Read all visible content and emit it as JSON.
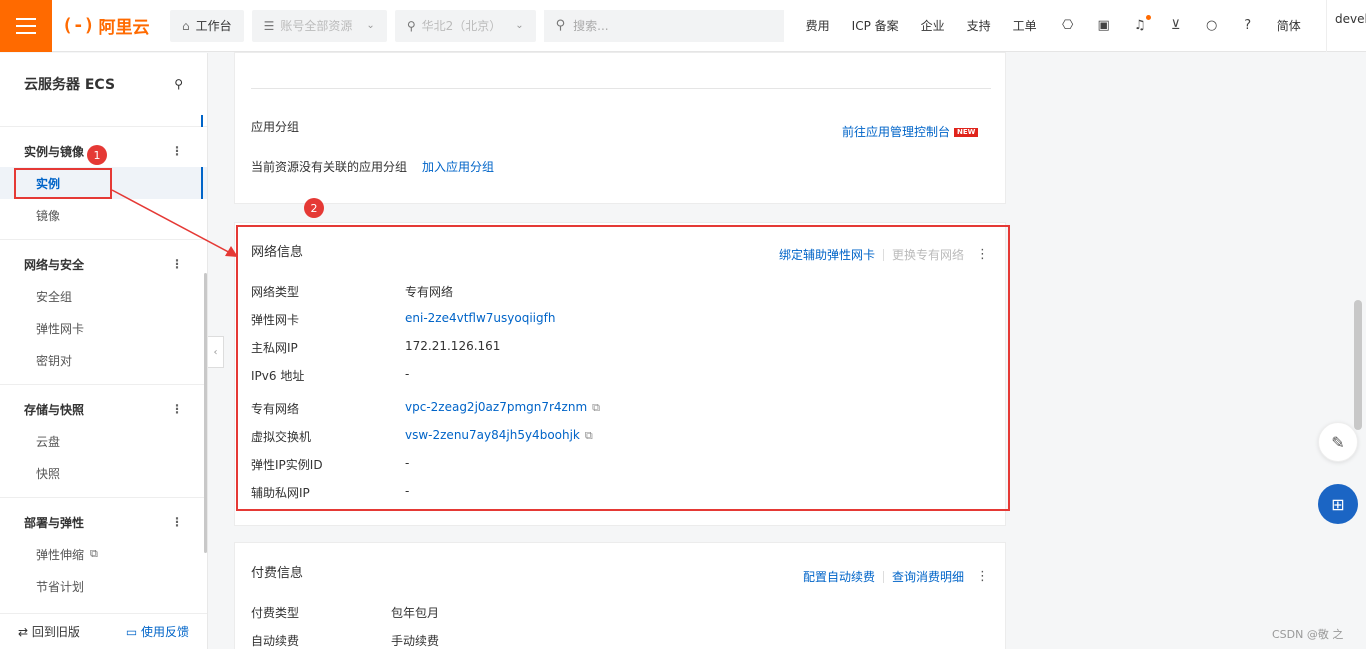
{
  "topbar": {
    "logo_mark": "(-)",
    "logo_text": "阿里云",
    "workbench": "工作台",
    "account_resources": "账号全部资源",
    "region": "华北2（北京）",
    "search_placeholder": "搜索...",
    "links": [
      "费用",
      "ICP 备案",
      "企业",
      "支持",
      "工单"
    ],
    "lang": "简体",
    "user": "devel"
  },
  "sidebar": {
    "title": "云服务器 ECS",
    "groups": [
      {
        "title": "实例与镜像",
        "items": [
          "实例",
          "镜像"
        ]
      },
      {
        "title": "网络与安全",
        "items": [
          "安全组",
          "弹性网卡",
          "密钥对"
        ]
      },
      {
        "title": "存储与快照",
        "items": [
          "云盘",
          "快照"
        ]
      },
      {
        "title": "部署与弹性",
        "items": [
          "弹性伸缩",
          "节省计划"
        ]
      }
    ],
    "footer_left": "回到旧版",
    "footer_right": "使用反馈"
  },
  "app_group": {
    "label": "应用分组",
    "goto_link": "前往应用管理控制台",
    "new_badge": "NEW",
    "empty_text": "当前资源没有关联的应用分组",
    "add_link": "加入应用分组"
  },
  "network": {
    "title": "网络信息",
    "action_bind": "绑定辅助弹性网卡",
    "action_change": "更换专有网络",
    "rows": [
      {
        "key": "网络类型",
        "value": "专有网络"
      },
      {
        "key": "弹性网卡",
        "value": "eni-2ze4vtflw7usyoqiigfh"
      },
      {
        "key": "主私网IP",
        "value": "172.21.126.161"
      },
      {
        "key": "IPv6 地址",
        "value": "-"
      },
      {
        "key": "专有网络",
        "value": "vpc-2zeag2j0az7pmgn7r4znm"
      },
      {
        "key": "虚拟交换机",
        "value": "vsw-2zenu7ay84jh5y4boohjk"
      },
      {
        "key": "弹性IP实例ID",
        "value": "-"
      },
      {
        "key": "辅助私网IP",
        "value": "-"
      }
    ]
  },
  "billing": {
    "title": "付费信息",
    "action_auto": "配置自动续费",
    "action_detail": "查询消费明细",
    "rows": [
      {
        "key": "付费类型",
        "value": "包年包月"
      },
      {
        "key": "自动续费",
        "value": "手动续费"
      }
    ]
  },
  "annotations": {
    "badge1": "1",
    "badge2": "2",
    "color": "#e53935"
  },
  "watermark": "CSDN @敬 之"
}
